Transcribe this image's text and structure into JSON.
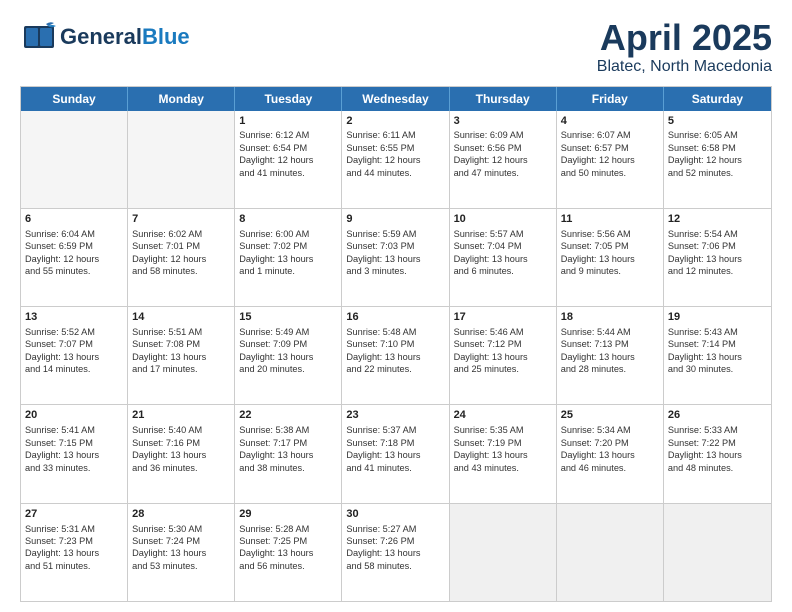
{
  "header": {
    "logo_general": "General",
    "logo_blue": "Blue",
    "title": "April 2025",
    "subtitle": "Blatec, North Macedonia"
  },
  "days_of_week": [
    "Sunday",
    "Monday",
    "Tuesday",
    "Wednesday",
    "Thursday",
    "Friday",
    "Saturday"
  ],
  "weeks": [
    [
      {
        "day": "",
        "empty": true
      },
      {
        "day": "",
        "empty": true
      },
      {
        "day": "1",
        "lines": [
          "Sunrise: 6:12 AM",
          "Sunset: 6:54 PM",
          "Daylight: 12 hours",
          "and 41 minutes."
        ]
      },
      {
        "day": "2",
        "lines": [
          "Sunrise: 6:11 AM",
          "Sunset: 6:55 PM",
          "Daylight: 12 hours",
          "and 44 minutes."
        ]
      },
      {
        "day": "3",
        "lines": [
          "Sunrise: 6:09 AM",
          "Sunset: 6:56 PM",
          "Daylight: 12 hours",
          "and 47 minutes."
        ]
      },
      {
        "day": "4",
        "lines": [
          "Sunrise: 6:07 AM",
          "Sunset: 6:57 PM",
          "Daylight: 12 hours",
          "and 50 minutes."
        ]
      },
      {
        "day": "5",
        "lines": [
          "Sunrise: 6:05 AM",
          "Sunset: 6:58 PM",
          "Daylight: 12 hours",
          "and 52 minutes."
        ]
      }
    ],
    [
      {
        "day": "6",
        "lines": [
          "Sunrise: 6:04 AM",
          "Sunset: 6:59 PM",
          "Daylight: 12 hours",
          "and 55 minutes."
        ]
      },
      {
        "day": "7",
        "lines": [
          "Sunrise: 6:02 AM",
          "Sunset: 7:01 PM",
          "Daylight: 12 hours",
          "and 58 minutes."
        ]
      },
      {
        "day": "8",
        "lines": [
          "Sunrise: 6:00 AM",
          "Sunset: 7:02 PM",
          "Daylight: 13 hours",
          "and 1 minute."
        ]
      },
      {
        "day": "9",
        "lines": [
          "Sunrise: 5:59 AM",
          "Sunset: 7:03 PM",
          "Daylight: 13 hours",
          "and 3 minutes."
        ]
      },
      {
        "day": "10",
        "lines": [
          "Sunrise: 5:57 AM",
          "Sunset: 7:04 PM",
          "Daylight: 13 hours",
          "and 6 minutes."
        ]
      },
      {
        "day": "11",
        "lines": [
          "Sunrise: 5:56 AM",
          "Sunset: 7:05 PM",
          "Daylight: 13 hours",
          "and 9 minutes."
        ]
      },
      {
        "day": "12",
        "lines": [
          "Sunrise: 5:54 AM",
          "Sunset: 7:06 PM",
          "Daylight: 13 hours",
          "and 12 minutes."
        ]
      }
    ],
    [
      {
        "day": "13",
        "lines": [
          "Sunrise: 5:52 AM",
          "Sunset: 7:07 PM",
          "Daylight: 13 hours",
          "and 14 minutes."
        ]
      },
      {
        "day": "14",
        "lines": [
          "Sunrise: 5:51 AM",
          "Sunset: 7:08 PM",
          "Daylight: 13 hours",
          "and 17 minutes."
        ]
      },
      {
        "day": "15",
        "lines": [
          "Sunrise: 5:49 AM",
          "Sunset: 7:09 PM",
          "Daylight: 13 hours",
          "and 20 minutes."
        ]
      },
      {
        "day": "16",
        "lines": [
          "Sunrise: 5:48 AM",
          "Sunset: 7:10 PM",
          "Daylight: 13 hours",
          "and 22 minutes."
        ]
      },
      {
        "day": "17",
        "lines": [
          "Sunrise: 5:46 AM",
          "Sunset: 7:12 PM",
          "Daylight: 13 hours",
          "and 25 minutes."
        ]
      },
      {
        "day": "18",
        "lines": [
          "Sunrise: 5:44 AM",
          "Sunset: 7:13 PM",
          "Daylight: 13 hours",
          "and 28 minutes."
        ]
      },
      {
        "day": "19",
        "lines": [
          "Sunrise: 5:43 AM",
          "Sunset: 7:14 PM",
          "Daylight: 13 hours",
          "and 30 minutes."
        ]
      }
    ],
    [
      {
        "day": "20",
        "lines": [
          "Sunrise: 5:41 AM",
          "Sunset: 7:15 PM",
          "Daylight: 13 hours",
          "and 33 minutes."
        ]
      },
      {
        "day": "21",
        "lines": [
          "Sunrise: 5:40 AM",
          "Sunset: 7:16 PM",
          "Daylight: 13 hours",
          "and 36 minutes."
        ]
      },
      {
        "day": "22",
        "lines": [
          "Sunrise: 5:38 AM",
          "Sunset: 7:17 PM",
          "Daylight: 13 hours",
          "and 38 minutes."
        ]
      },
      {
        "day": "23",
        "lines": [
          "Sunrise: 5:37 AM",
          "Sunset: 7:18 PM",
          "Daylight: 13 hours",
          "and 41 minutes."
        ]
      },
      {
        "day": "24",
        "lines": [
          "Sunrise: 5:35 AM",
          "Sunset: 7:19 PM",
          "Daylight: 13 hours",
          "and 43 minutes."
        ]
      },
      {
        "day": "25",
        "lines": [
          "Sunrise: 5:34 AM",
          "Sunset: 7:20 PM",
          "Daylight: 13 hours",
          "and 46 minutes."
        ]
      },
      {
        "day": "26",
        "lines": [
          "Sunrise: 5:33 AM",
          "Sunset: 7:22 PM",
          "Daylight: 13 hours",
          "and 48 minutes."
        ]
      }
    ],
    [
      {
        "day": "27",
        "lines": [
          "Sunrise: 5:31 AM",
          "Sunset: 7:23 PM",
          "Daylight: 13 hours",
          "and 51 minutes."
        ]
      },
      {
        "day": "28",
        "lines": [
          "Sunrise: 5:30 AM",
          "Sunset: 7:24 PM",
          "Daylight: 13 hours",
          "and 53 minutes."
        ]
      },
      {
        "day": "29",
        "lines": [
          "Sunrise: 5:28 AM",
          "Sunset: 7:25 PM",
          "Daylight: 13 hours",
          "and 56 minutes."
        ]
      },
      {
        "day": "30",
        "lines": [
          "Sunrise: 5:27 AM",
          "Sunset: 7:26 PM",
          "Daylight: 13 hours",
          "and 58 minutes."
        ]
      },
      {
        "day": "",
        "empty": true,
        "shaded": true
      },
      {
        "day": "",
        "empty": true,
        "shaded": true
      },
      {
        "day": "",
        "empty": true,
        "shaded": true
      }
    ]
  ]
}
